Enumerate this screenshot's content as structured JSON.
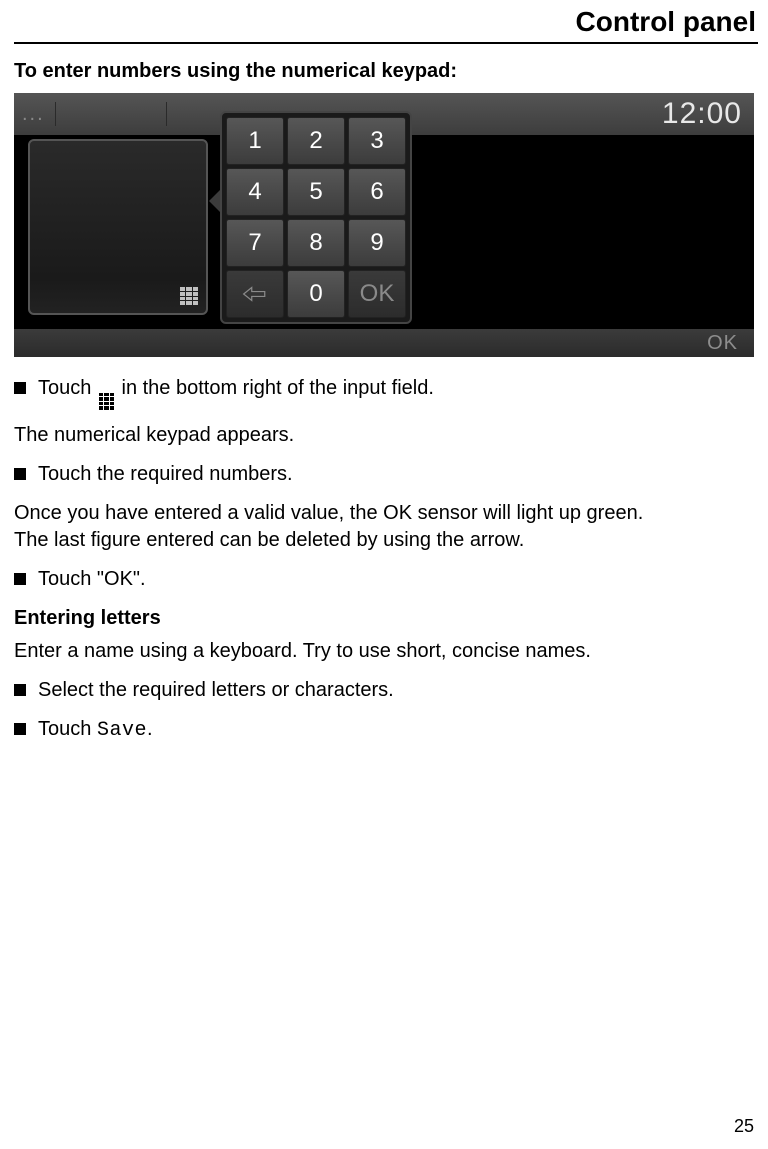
{
  "header": {
    "title": "Control panel"
  },
  "section1": {
    "heading": "To enter numbers using the numerical keypad:"
  },
  "panel": {
    "time": "12:00",
    "footer_ok": "OK",
    "topbar_dots": "..."
  },
  "keypad": {
    "keys": [
      "1",
      "2",
      "3",
      "4",
      "5",
      "6",
      "7",
      "8",
      "9"
    ],
    "zero": "0",
    "ok": "OK"
  },
  "body": {
    "step1_pre": "Touch ",
    "step1_post": " in the bottom right of the input field.",
    "para1": "The numerical keypad appears.",
    "step2": "Touch the required numbers.",
    "para2": "Once you have entered a valid value, the OK sensor will light up green.\nThe last figure entered can be deleted by using the arrow.",
    "step3": "Touch \"OK\".",
    "heading2": "Entering letters",
    "para3": "Enter a name using a keyboard. Try to use short, concise names.",
    "step4": "Select the required letters or characters.",
    "step5_pre": "Touch ",
    "step5_save": "Save",
    "step5_post": "."
  },
  "page_number": "25"
}
